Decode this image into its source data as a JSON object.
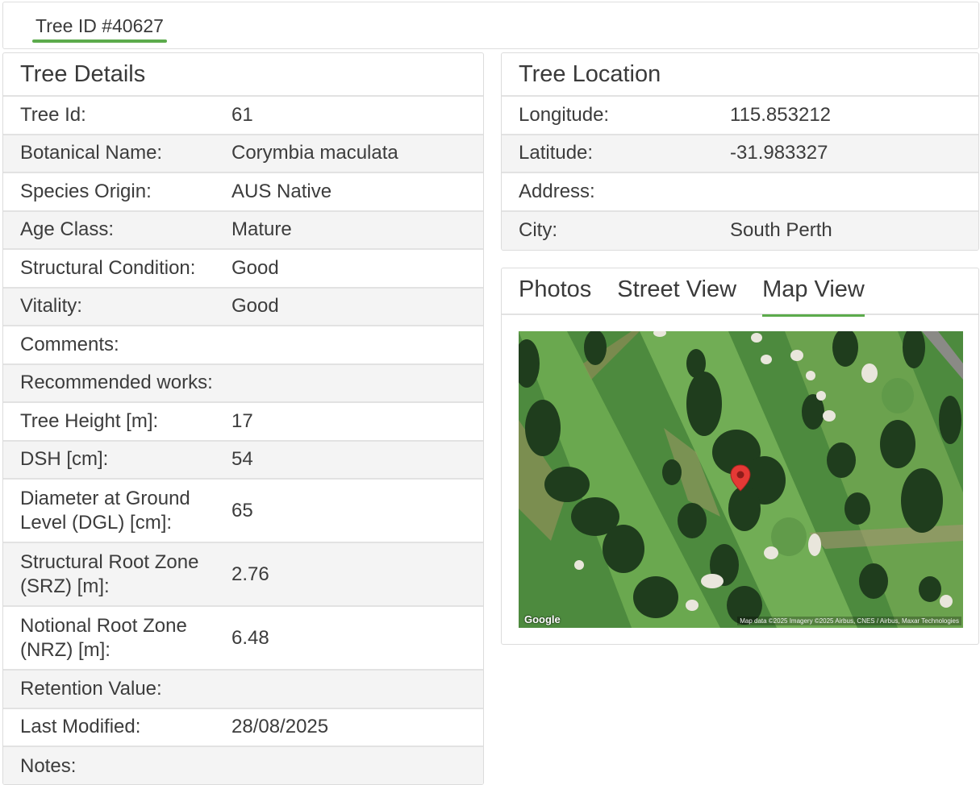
{
  "tabs": {
    "main": "Tree ID #40627"
  },
  "details": {
    "title": "Tree Details",
    "rows": [
      {
        "label": "Tree Id:",
        "value": "61"
      },
      {
        "label": "Botanical Name:",
        "value": "Corymbia maculata"
      },
      {
        "label": "Species Origin:",
        "value": "AUS Native"
      },
      {
        "label": "Age Class:",
        "value": "Mature"
      },
      {
        "label": "Structural Condition:",
        "value": "Good"
      },
      {
        "label": "Vitality:",
        "value": "Good"
      },
      {
        "label": "Comments:",
        "value": ""
      },
      {
        "label": "Recommended works:",
        "value": ""
      },
      {
        "label": "Tree Height [m]:",
        "value": "17"
      },
      {
        "label": "DSH [cm]:",
        "value": "54"
      },
      {
        "label": "Diameter at Ground Level (DGL) [cm]:",
        "value": "65"
      },
      {
        "label": "Structural Root Zone (SRZ) [m]:",
        "value": "2.76"
      },
      {
        "label": "Notional Root Zone (NRZ) [m]:",
        "value": "6.48"
      },
      {
        "label": "Retention Value:",
        "value": ""
      },
      {
        "label": "Last Modified:",
        "value": "28/08/2025"
      },
      {
        "label": "Notes:",
        "value": ""
      }
    ]
  },
  "location": {
    "title": "Tree Location",
    "rows": [
      {
        "label": "Longitude:",
        "value": "115.853212"
      },
      {
        "label": "Latitude:",
        "value": "-31.983327"
      },
      {
        "label": "Address:",
        "value": ""
      },
      {
        "label": "City:",
        "value": "South Perth"
      }
    ]
  },
  "media": {
    "tabs": [
      {
        "label": "Photos",
        "active": false
      },
      {
        "label": "Street View",
        "active": false
      },
      {
        "label": "Map View",
        "active": true
      }
    ],
    "map": {
      "google_label": "Google",
      "attribution": "Map data ©2025 Imagery ©2025 Airbus, CNES / Airbus, Maxar Technologies"
    }
  },
  "colors": {
    "accent": "#5cab4c",
    "marker": "#e53935"
  },
  "icons": {
    "map_marker": "map-marker-icon"
  }
}
